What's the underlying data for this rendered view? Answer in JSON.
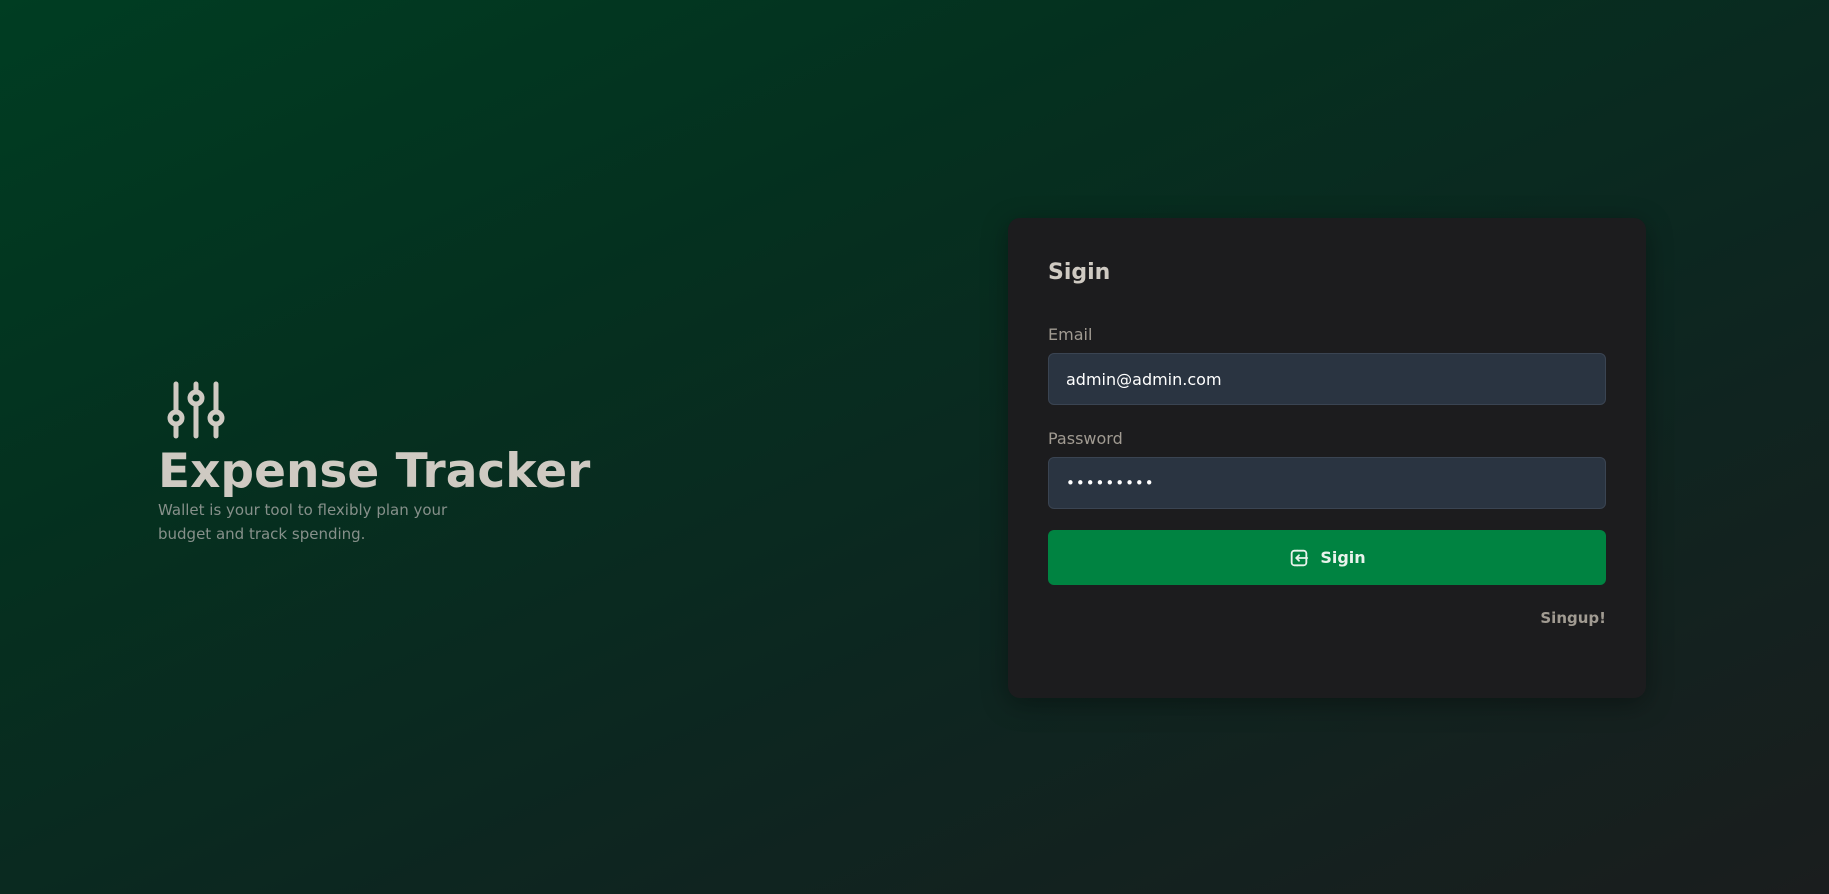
{
  "brand": {
    "icon": "sliders-icon",
    "title": "Expense Tracker",
    "description": "Wallet is your tool to flexibly plan your budget and track spending."
  },
  "login": {
    "title": "Sigin",
    "email_label": "Email",
    "email_value": "admin@admin.com",
    "password_label": "Password",
    "password_value": "•••••••••",
    "submit_label": "Sigin",
    "submit_icon": "login-icon",
    "signup_label": "Singup!"
  },
  "colors": {
    "background_start": "#003d22",
    "background_end": "#1a1d1e",
    "card_background": "#1c1c1e",
    "input_background": "#2a3441",
    "primary_button": "#008341",
    "heading_text": "#cfcac2",
    "muted_text": "#a19b92"
  }
}
